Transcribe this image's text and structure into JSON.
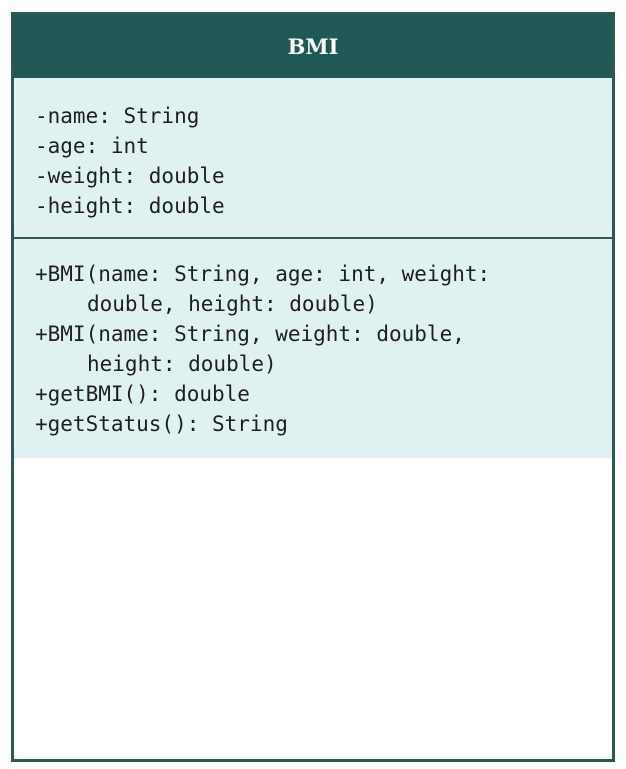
{
  "class": {
    "name": "BMI",
    "attributes": [
      "-name: String",
      "-age: int",
      "-weight: double",
      "-height: double"
    ],
    "operations": [
      "+BMI(name: String, age: int, weight:",
      "double, height: double)",
      "+BMI(name: String, weight: double,",
      "height: double)",
      "+getBMI(): double",
      "+getStatus(): String"
    ]
  }
}
